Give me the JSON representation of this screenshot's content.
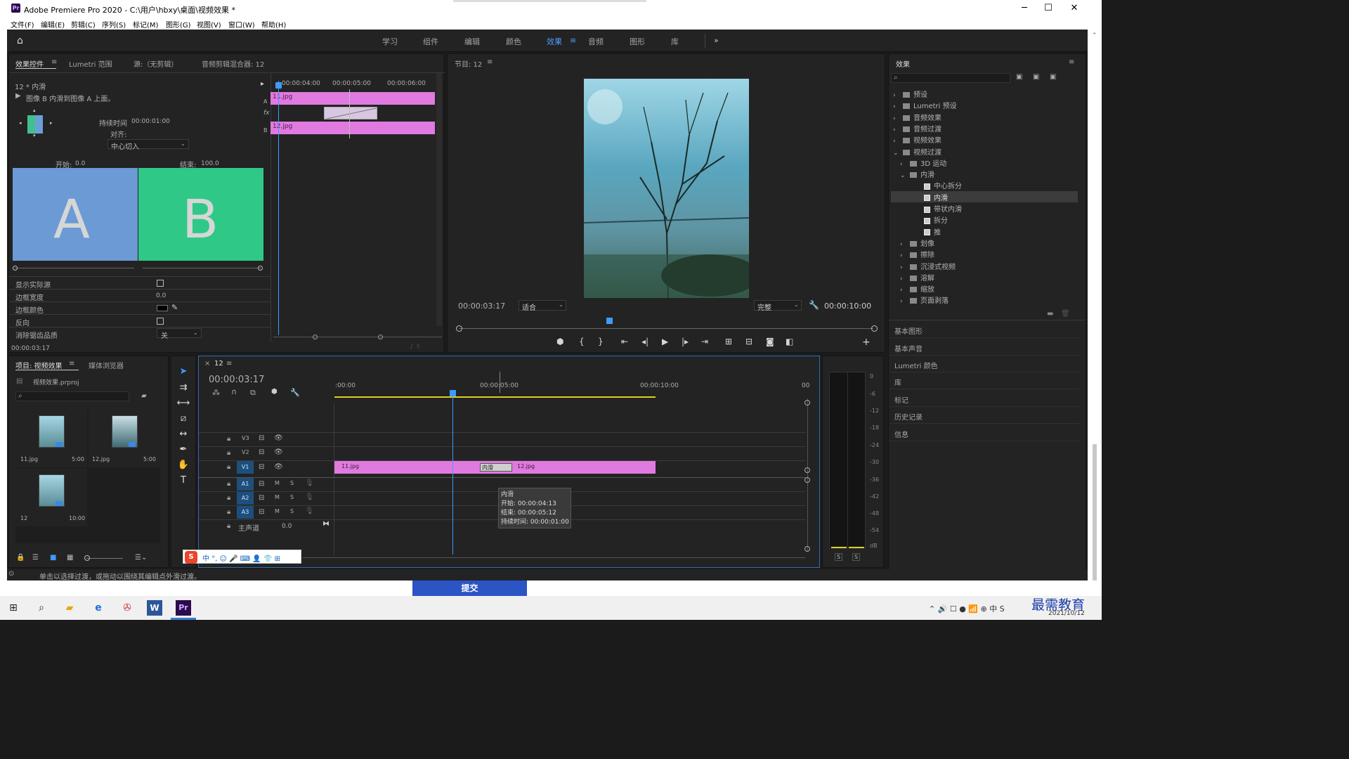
{
  "window": {
    "title": "Adobe Premiere Pro 2020 - C:\\用户\\hbxy\\桌面\\视频效果 *"
  },
  "menu": [
    "文件(F)",
    "编辑(E)",
    "剪辑(C)",
    "序列(S)",
    "标记(M)",
    "图形(G)",
    "视图(V)",
    "窗口(W)",
    "帮助(H)"
  ],
  "workspaces": [
    "学习",
    "组件",
    "编辑",
    "颜色",
    "效果",
    "音频",
    "图形",
    "库"
  ],
  "active_workspace": "效果",
  "effect_controls": {
    "tabs": [
      "效果控件",
      "Lumetri 范围",
      "源:（无剪辑）",
      "音频剪辑混合器: 12"
    ],
    "clip": "12 * 内滑",
    "desc": "图像 B 内滑到图像 A 上面。",
    "duration_label": "持续时间",
    "duration": "00:00:01:00",
    "align_label": "对齐:",
    "align_value": "中心切入",
    "start_label": "开始:",
    "start_value": "0.0",
    "end_label": "结束:",
    "end_value": "100.0",
    "preview_a": "A",
    "preview_b": "B",
    "props": [
      {
        "label": "显示实际源"
      },
      {
        "label": "边框宽度",
        "value": "0.0"
      },
      {
        "label": "边框颜色"
      },
      {
        "label": "反向"
      },
      {
        "label": "消除锯齿品质",
        "value": "关"
      }
    ],
    "time": "00:00:03:17",
    "ruler": [
      "00:00:04:00",
      "00:00:05:00",
      "00:00:06:00"
    ],
    "track_a_clip": "11.jpg",
    "track_b_clip": "12.jpg",
    "track_a_label": "A",
    "track_b_label": "B"
  },
  "program": {
    "title": "节目: 12",
    "timecode": "00:00:03:17",
    "fit": "适合",
    "quality": "完整",
    "duration": "00:00:10:00"
  },
  "effects": {
    "title": "效果",
    "tree": [
      {
        "label": "预设",
        "lvl": 0,
        "t": "folder"
      },
      {
        "label": "Lumetri 预设",
        "lvl": 0,
        "t": "folder"
      },
      {
        "label": "音频效果",
        "lvl": 0,
        "t": "folder"
      },
      {
        "label": "音频过渡",
        "lvl": 0,
        "t": "folder"
      },
      {
        "label": "视频效果",
        "lvl": 0,
        "t": "folder"
      },
      {
        "label": "视频过渡",
        "lvl": 0,
        "t": "folder",
        "open": true
      },
      {
        "label": "3D 运动",
        "lvl": 1,
        "t": "folder"
      },
      {
        "label": "内滑",
        "lvl": 1,
        "t": "folder",
        "open": true
      },
      {
        "label": "中心拆分",
        "lvl": 2,
        "t": "effect"
      },
      {
        "label": "内滑",
        "lvl": 2,
        "t": "effect",
        "selected": true
      },
      {
        "label": "带状内滑",
        "lvl": 2,
        "t": "effect"
      },
      {
        "label": "拆分",
        "lvl": 2,
        "t": "effect"
      },
      {
        "label": "推",
        "lvl": 2,
        "t": "effect"
      },
      {
        "label": "划像",
        "lvl": 1,
        "t": "folder"
      },
      {
        "label": "擦除",
        "lvl": 1,
        "t": "folder"
      },
      {
        "label": "沉浸式视频",
        "lvl": 1,
        "t": "folder"
      },
      {
        "label": "溶解",
        "lvl": 1,
        "t": "folder"
      },
      {
        "label": "缩放",
        "lvl": 1,
        "t": "folder"
      },
      {
        "label": "页面剥落",
        "lvl": 1,
        "t": "folder"
      }
    ],
    "sections": [
      "基本图形",
      "基本声音",
      "Lumetri 颜色",
      "库",
      "标记",
      "历史记录",
      "信息"
    ]
  },
  "project": {
    "tabs": [
      "项目: 视频效果",
      "媒体浏览器"
    ],
    "file": "视频效果.prproj",
    "items": [
      {
        "name": "11.jpg",
        "dur": "5:00"
      },
      {
        "name": "12.jpg",
        "dur": "5:00"
      },
      {
        "name": "12",
        "dur": "10:00"
      }
    ]
  },
  "timeline": {
    "seq": "12",
    "timecode": "00:00:03:17",
    "ruler": [
      ":00:00",
      "00:00:05:00",
      "00:00:10:00",
      "00"
    ],
    "video_tracks": [
      "V3",
      "V2",
      "V1"
    ],
    "audio_tracks": [
      "A1",
      "A2",
      "A3"
    ],
    "master": "主声道",
    "master_val": "0.0",
    "clip1": "11.jpg",
    "clip2": "12.jpg",
    "transition": "内滑",
    "tooltip": [
      "内滑",
      "开始: 00:00:04:13",
      "结束: 00:00:05:12",
      "持续时间: 00:00:01:00"
    ],
    "m": "M",
    "s": "S"
  },
  "meter": {
    "ticks": [
      "0",
      "-6",
      "-12",
      "-18",
      "-24",
      "-30",
      "-36",
      "-42",
      "-48",
      "-54",
      "dB"
    ],
    "solo": "S"
  },
  "status": "单击以选择过渡，或拖动以围绕其编辑点外滑过渡。",
  "submit": "提交",
  "taskbar": {
    "date": "2021/10/12",
    "brand": "最需教育"
  }
}
